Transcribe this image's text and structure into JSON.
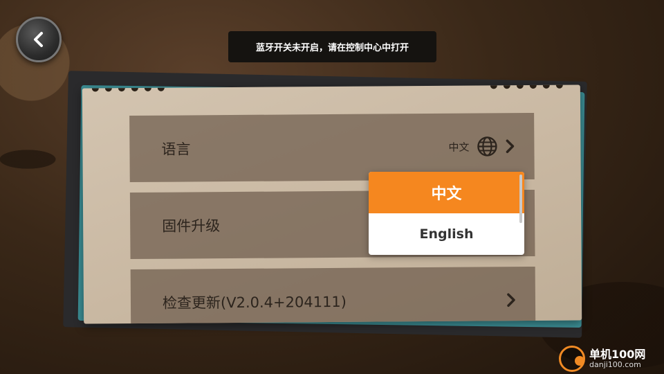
{
  "toast": {
    "message": "蓝牙开关未开启，请在控制中心中打开"
  },
  "settings": {
    "rows": [
      {
        "label": "语言",
        "value": "中文"
      },
      {
        "label": "固件升级"
      },
      {
        "label": "检查更新(V2.0.4+204111)"
      }
    ]
  },
  "language_dropdown": {
    "options": [
      "中文",
      "English"
    ],
    "selected": "中文"
  },
  "watermark": {
    "title": "单机100网",
    "url": "danji100.com"
  },
  "colors": {
    "accent": "#f5871f",
    "card": "#cdbda8",
    "row": "#6e5c4c"
  }
}
